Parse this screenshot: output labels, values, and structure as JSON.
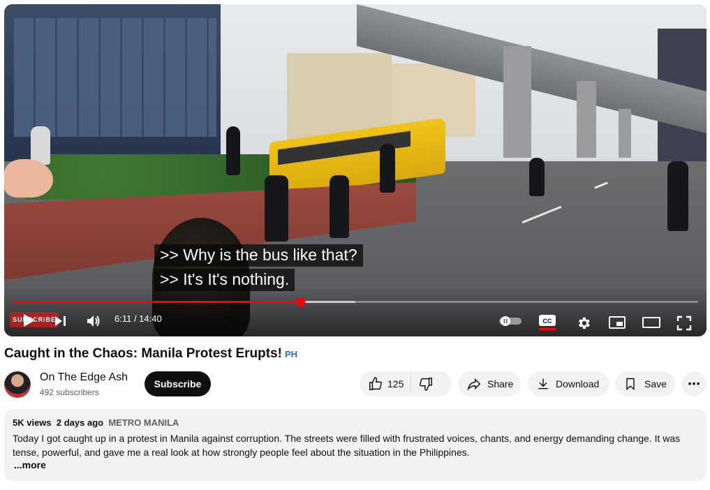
{
  "player": {
    "captions": [
      ">> Why is the bus like that?",
      ">> It's It's nothing."
    ],
    "time_display": "6:11 / 14:40",
    "progress_played": 0.42,
    "progress_buffered": 0.5,
    "subscribe_overlay_label": "SUBSCRIBE",
    "icons": [
      "play-icon",
      "next-icon",
      "volume-icon",
      "autoplay-toggle-icon",
      "captions-icon",
      "settings-icon",
      "miniplayer-icon",
      "theater-icon",
      "fullscreen-icon"
    ],
    "accent_color": "#ff0000"
  },
  "video": {
    "title": "Caught in the Chaos: Manila Protest Erupts!",
    "title_flag": "PH"
  },
  "channel": {
    "name": "On The Edge Ash",
    "subscribers": "492 subscribers",
    "subscribe_label": "Subscribe"
  },
  "actions": {
    "like_count": "125",
    "share_label": "Share",
    "download_label": "Download",
    "save_label": "Save",
    "more_label": "⋯"
  },
  "description": {
    "views": "5K views",
    "date": "2 days ago",
    "location": "METRO MANILA",
    "text": "Today I got caught up in a protest in Manila against corruption. The streets were filled with frustrated voices, chants, and energy demanding change. It was tense, powerful, and gave me a real look at how strongly people feel about the situation in the Philippines.",
    "more_label": "...more"
  }
}
